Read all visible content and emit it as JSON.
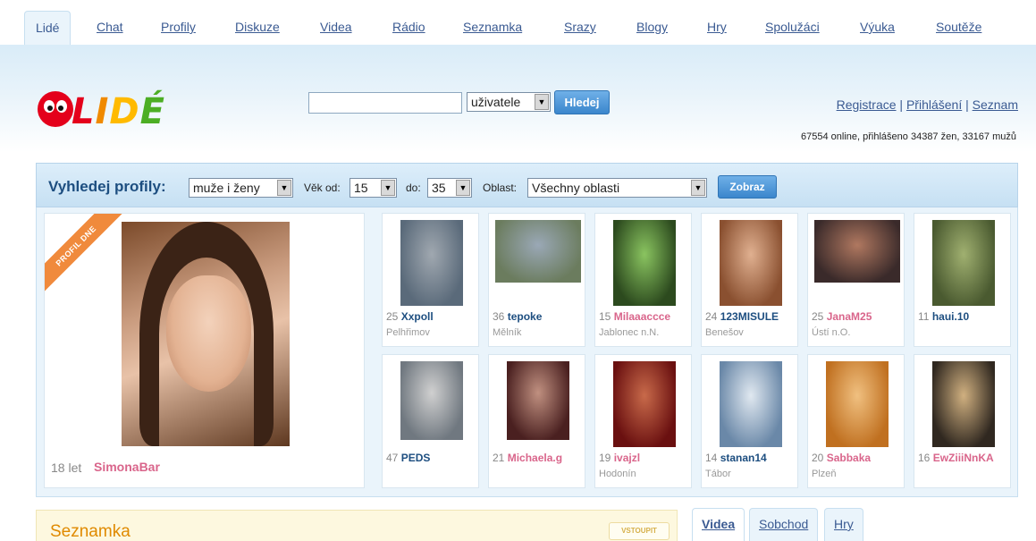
{
  "topnav": {
    "tabs": [
      {
        "label": "Lidé"
      },
      {
        "label": "Chat"
      },
      {
        "label": "Profily"
      },
      {
        "label": "Diskuze"
      },
      {
        "label": "Videa"
      },
      {
        "label": "Rádio"
      },
      {
        "label": "Seznamka"
      },
      {
        "label": "Srazy"
      },
      {
        "label": "Blogy"
      },
      {
        "label": "Hry"
      },
      {
        "label": "Spolužáci"
      },
      {
        "label": "Výuka"
      },
      {
        "label": "Soutěže"
      }
    ]
  },
  "header": {
    "logo": "LIDÉ",
    "search": {
      "value": "",
      "scope": "uživatele",
      "button": "Hledej"
    },
    "auth": {
      "register": "Registrace",
      "login": "Přihlášení",
      "list": "Seznam",
      "separator": "|"
    },
    "stats": "67554 online, přihlášeno 34387 žen, 33167 mužů"
  },
  "profile_search": {
    "title": "Vyhledej profily:",
    "gender": "muže i ženy",
    "age_from_label": "Věk od:",
    "age_from": "15",
    "age_to_label": "do:",
    "age_to": "35",
    "region_label": "Oblast:",
    "region": "Všechny oblasti",
    "button": "Zobraz"
  },
  "featured": {
    "ribbon": "PROFIL DNE",
    "age": "18 let",
    "name": "SimonaBar"
  },
  "profiles": [
    {
      "age": "25",
      "name": "Xxpoll",
      "city": "Pelhřimov",
      "gender": "m"
    },
    {
      "age": "36",
      "name": "tepoke",
      "city": "Mělník",
      "gender": "m"
    },
    {
      "age": "15",
      "name": "Milaaaccce",
      "city": "Jablonec n.N.",
      "gender": "f"
    },
    {
      "age": "24",
      "name": "123MISULE",
      "city": "Benešov",
      "gender": "m"
    },
    {
      "age": "25",
      "name": "JanaM25",
      "city": "Ústí n.O.",
      "gender": "f"
    },
    {
      "age": "11",
      "name": "haui.10",
      "city": "",
      "gender": "m"
    },
    {
      "age": "47",
      "name": "PEDS",
      "city": "",
      "gender": "m"
    },
    {
      "age": "21",
      "name": "Michaela.g",
      "city": "",
      "gender": "f"
    },
    {
      "age": "19",
      "name": "ivajzl",
      "city": "Hodonín",
      "gender": "f"
    },
    {
      "age": "14",
      "name": "stanan14",
      "city": "Tábor",
      "gender": "m"
    },
    {
      "age": "20",
      "name": "Sabbaka",
      "city": "Plzeň",
      "gender": "f"
    },
    {
      "age": "16",
      "name": "EwZiiiNnKA",
      "city": "",
      "gender": "f"
    }
  ],
  "bottom": {
    "seznamka_title": "Seznamka",
    "vstoupit": "VSTOUPIT",
    "tabs": [
      {
        "label": "Videa"
      },
      {
        "label": "Sobchod"
      },
      {
        "label": "Hry"
      }
    ]
  },
  "colors": {
    "accent": "#3a5a92",
    "female_name": "#d9658b",
    "male_name": "#1d4e80",
    "ribbon": "#f08a3c"
  }
}
